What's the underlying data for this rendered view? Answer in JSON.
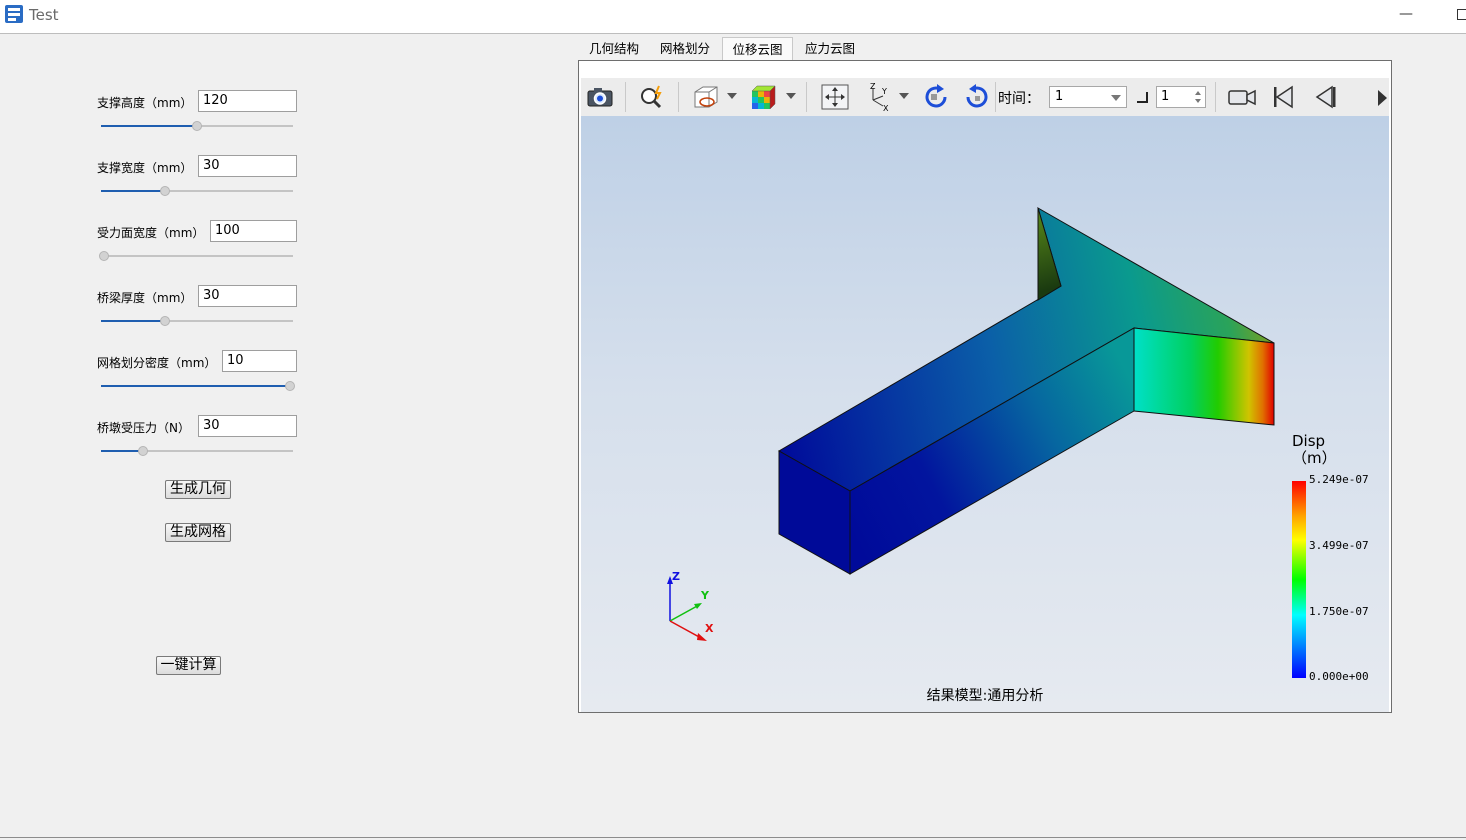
{
  "window": {
    "title": "Test",
    "minimize_label": "—"
  },
  "params": [
    {
      "label": "支撑高度（mm）",
      "value": "120",
      "slider_fraction": 0.5
    },
    {
      "label": "支撑宽度（mm）",
      "value": "30",
      "slider_fraction": 0.33
    },
    {
      "label": "受力面宽度（mm）",
      "value": "100",
      "slider_fraction": 0.0
    },
    {
      "label": "桥梁厚度（mm）",
      "value": "30",
      "slider_fraction": 0.33
    },
    {
      "label": "网格划分密度（mm）",
      "value": "10",
      "slider_fraction": 1.0
    },
    {
      "label": "桥墩受压力（N）",
      "value": "30",
      "slider_fraction": 0.21
    }
  ],
  "buttons": {
    "generate_geometry": "生成几何",
    "generate_mesh": "生成网格",
    "one_click_compute": "一键计算"
  },
  "tabs": [
    {
      "label": "几何结构",
      "active": false
    },
    {
      "label": "网格划分",
      "active": false
    },
    {
      "label": "位移云图",
      "active": true
    },
    {
      "label": "应力云图",
      "active": false
    }
  ],
  "toolbar": {
    "time_label": "时间：",
    "time_value": "1",
    "step_value": "1",
    "icons": [
      "camera-icon",
      "query-icon",
      "display-mode-icon",
      "color-cube-icon",
      "fit-view-icon",
      "axes-icon",
      "rotate-cw-icon",
      "rotate-ccw-icon",
      "record-icon",
      "first-frame-icon",
      "previous-frame-icon",
      "next-frame-icon"
    ]
  },
  "viewer": {
    "caption": "结果模型:通用分析",
    "axes": {
      "z": "Z",
      "y": "Y",
      "x": "X"
    }
  },
  "legend": {
    "title_line1": "Disp",
    "title_line2": "（m）",
    "max": "5.249e-07",
    "mid_high": "3.499e-07",
    "mid_low": "1.750e-07",
    "min": "0.000e+00",
    "colors": [
      "#ff0000",
      "#ffff00",
      "#00ff00",
      "#00ffff",
      "#0000ff"
    ]
  }
}
